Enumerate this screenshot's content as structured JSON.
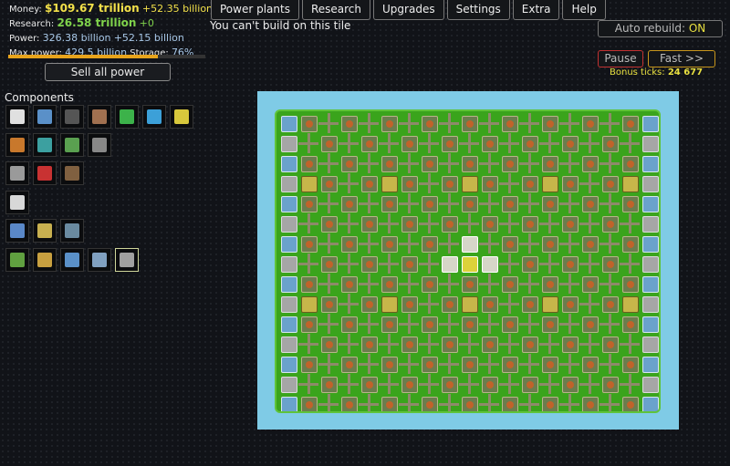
{
  "stats": {
    "money_label": "Money:",
    "money_value": "$109.67 trillion",
    "money_income": "+52.35 billion",
    "research_label": "Research:",
    "research_value": "26.58 trillion",
    "research_income": "+0",
    "power_label": "Power:",
    "power_value": "326.38 billion",
    "power_income": "+52.15 billion",
    "max_power_label": "Max power:",
    "max_power_value": "429.5 billion",
    "storage_label": "Storage:",
    "storage_value": "76%",
    "power_fill": 0.76
  },
  "sell_button": "Sell all power",
  "menu": [
    "Power plants",
    "Research",
    "Upgrades",
    "Settings",
    "Extra",
    "Help"
  ],
  "message": "You can't build on this tile",
  "auto_rebuild_label": "Auto rebuild:",
  "auto_rebuild_value": "ON",
  "pause_label": "Pause",
  "fast_label": "Fast >>",
  "bonus_label": "Bonus ticks:",
  "bonus_value": "24 677",
  "components_title": "Components",
  "components_rows": [
    [
      {
        "icon": "wind-turbine-icon",
        "color": "#e0e0e0"
      },
      {
        "icon": "solar-panel-icon",
        "color": "#5a90c8"
      },
      {
        "icon": "coal-plant-icon",
        "color": "#555"
      },
      {
        "icon": "factory-icon",
        "color": "#a07050"
      },
      {
        "icon": "green-cell-icon",
        "color": "#3cb24a"
      },
      {
        "icon": "blue-cell-icon",
        "color": "#3ca0d8"
      },
      {
        "icon": "yellow-cell-icon",
        "color": "#d8c83c"
      }
    ],
    [
      {
        "icon": "orange-heat-icon",
        "color": "#c8782c"
      },
      {
        "icon": "teal-heat-icon",
        "color": "#3ca0a0"
      },
      {
        "icon": "green-heat-icon",
        "color": "#5aa050"
      },
      {
        "icon": "pipe-icon",
        "color": "#888"
      }
    ],
    [
      {
        "icon": "gray-box-icon",
        "color": "#9a9a9a"
      },
      {
        "icon": "red-battery-icon",
        "color": "#c83232"
      },
      {
        "icon": "vent-icon",
        "color": "#806040"
      }
    ],
    [
      {
        "icon": "generator-icon",
        "color": "#d8d8d8"
      }
    ],
    [
      {
        "icon": "blue-ground-icon",
        "color": "#5a88c8"
      },
      {
        "icon": "yellow-ground-icon",
        "color": "#c8b050"
      },
      {
        "icon": "cross-pipe-icon",
        "color": "#6a8aa0"
      }
    ],
    [
      {
        "icon": "house-icon",
        "color": "#60a040"
      },
      {
        "icon": "shop-icon",
        "color": "#c8a040"
      },
      {
        "icon": "office-icon",
        "color": "#5a90c8"
      },
      {
        "icon": "building-icon",
        "color": "#80a0c0"
      },
      {
        "icon": "bank-icon",
        "color": "#a0a0a0",
        "selected": true
      }
    ]
  ]
}
